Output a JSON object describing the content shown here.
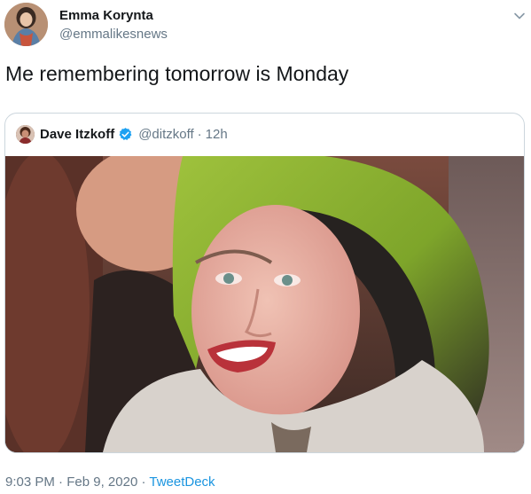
{
  "author": {
    "name": "Emma Korynta",
    "handle": "@emmalikesnews",
    "avatar_icon": "user-avatar-photo"
  },
  "tweet": {
    "text": "Me remembering tomorrow is Monday"
  },
  "menu_icon": "chevron-down-icon",
  "quoted_tweet": {
    "name": "Dave Itzkoff",
    "verified": true,
    "handle": "@ditzkoff",
    "separator": "·",
    "time": "12h",
    "media_description_icon": "photo"
  },
  "footer": {
    "time": "9:03 PM",
    "separator1": "·",
    "date": "Feb 9, 2020",
    "separator2": "·",
    "source": "TweetDeck"
  },
  "colors": {
    "text": "#14171a",
    "secondary": "#657786",
    "link": "#1b95e0",
    "verified": "#1da1f2",
    "border": "#ccd6dd"
  }
}
